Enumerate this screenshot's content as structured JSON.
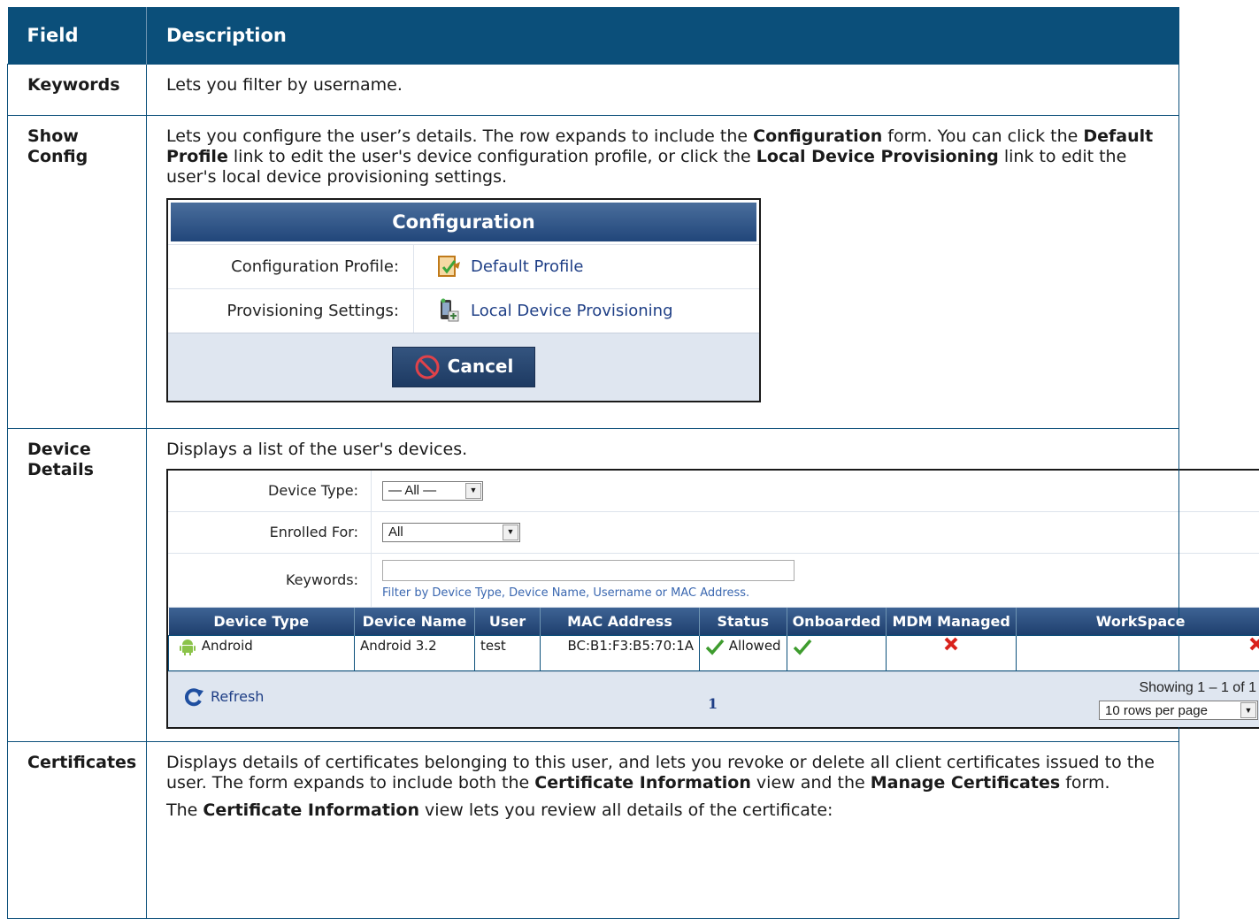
{
  "table": {
    "headers": [
      "Field",
      "Description"
    ],
    "rows": [
      {
        "field": "Keywords",
        "desc": "Lets you filter by username."
      },
      {
        "field": "Show Config",
        "desc_parts": [
          "Lets you configure the user’s details. The row expands to include the ",
          "Configuration",
          " form. You can click the ",
          "Default Profile",
          " link to edit the user's device configuration profile, or click the ",
          "Local Device Provisioning",
          " link to edit the user's local device provisioning settings."
        ]
      },
      {
        "field": "Device Details",
        "desc": "Displays a list of the user's devices."
      },
      {
        "field": "Certificates",
        "desc_parts": [
          "Displays details of certificates belonging to this user, and lets you revoke or delete all client certificates issued to the user. The form expands to include both the ",
          "Certificate Information",
          " view and the ",
          "Manage Certificates",
          " form."
        ],
        "desc2_parts": [
          "The ",
          "Certificate Information",
          " view lets you review all details of the certificate:"
        ]
      }
    ]
  },
  "config_form": {
    "title": "Configuration",
    "rows": [
      {
        "label": "Configuration Profile:",
        "value": "Default Profile",
        "icon": "profile-icon"
      },
      {
        "label": "Provisioning Settings:",
        "value": "Local Device Provisioning",
        "icon": "device-provisioning-icon"
      }
    ],
    "cancel_label": "Cancel"
  },
  "device_list": {
    "filters": {
      "device_type_label": "Device Type:",
      "device_type_value": "— All —",
      "enrolled_label": "Enrolled For:",
      "enrolled_value": "All",
      "keywords_label": "Keywords:",
      "keywords_hint": "Filter by Device Type, Device Name, Username or MAC Address."
    },
    "columns": [
      "Device Type",
      "Device Name",
      "User",
      "MAC Address",
      "Status",
      "Onboarded",
      "MDM Managed",
      "WorkSpace"
    ],
    "rows": [
      {
        "device_type": "Android",
        "device_name": "Android 3.2",
        "user": "test",
        "mac": "BC:B1:F3:B5:70:1A",
        "status": "Allowed",
        "onboarded": true,
        "mdm_managed": false,
        "workspace": false
      }
    ],
    "refresh_label": "Refresh",
    "page": "1",
    "showing": "Showing 1 – 1 of 1",
    "rows_per_page": "10 rows per page"
  },
  "colors": {
    "header_bg": "#0b4f7a",
    "form_header": "#21467a",
    "link": "#1f3f86"
  }
}
